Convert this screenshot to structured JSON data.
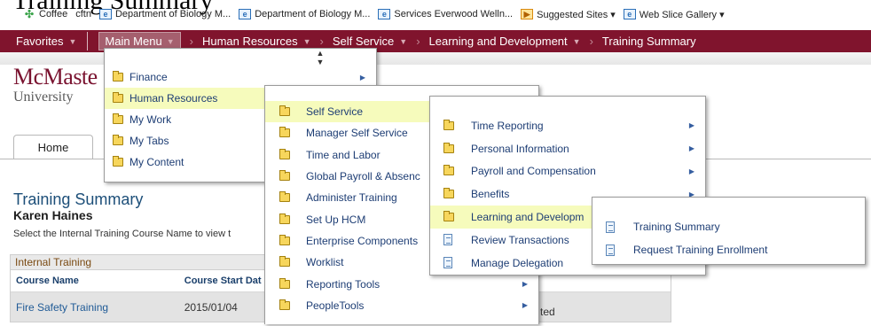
{
  "browser": {
    "page_title_fragment": "Training Summary",
    "favorites": [
      {
        "label": "Coffee",
        "icon": "green-leaf-icon"
      },
      {
        "label": "cftn",
        "icon": "page-icon"
      },
      {
        "label": "Department of Biology M...",
        "icon": "page-icon"
      },
      {
        "label": "Department of Biology M...",
        "icon": "page-icon"
      },
      {
        "label": "Services  Everwood Welln...",
        "icon": "page-icon"
      },
      {
        "label": "Suggested Sites ▾",
        "icon": "suggested-sites-icon"
      },
      {
        "label": "Web Slice Gallery ▾",
        "icon": "page-icon"
      }
    ]
  },
  "navbar": {
    "favorites": "Favorites",
    "main_menu": "Main Menu",
    "breadcrumbs": [
      "Human Resources",
      "Self Service",
      "Learning and Development",
      "Training Summary"
    ]
  },
  "logo": {
    "name": "McMaste",
    "sub": "University"
  },
  "tabs": [
    {
      "label": "Home"
    }
  ],
  "page": {
    "title": "Training Summary",
    "person": "Karen Haines",
    "instruction": "Select the Internal Training Course Name to view t"
  },
  "grid": {
    "title": "Internal Training",
    "columns": [
      "Course Name",
      "Course Start Dat",
      "",
      ""
    ],
    "rows": [
      {
        "course": "Fire Safety Training",
        "start": "2015/01/04",
        "col3": "",
        "status_fragment": "ted"
      }
    ]
  },
  "menus": {
    "main": [
      {
        "label": "Finance",
        "icon": "folder-icon",
        "arrow": true
      },
      {
        "label": "Human Resources",
        "icon": "folder-icon",
        "arrow": false,
        "highlighted": true
      },
      {
        "label": "My Work",
        "icon": "folder-icon",
        "arrow": false
      },
      {
        "label": "My Tabs",
        "icon": "folder-icon",
        "arrow": false
      },
      {
        "label": "My Content",
        "icon": "folder-icon",
        "arrow": false
      }
    ],
    "human_resources": [
      {
        "label": "Self Service",
        "icon": "folder-icon",
        "highlighted": true
      },
      {
        "label": "Manager Self Service",
        "icon": "folder-icon"
      },
      {
        "label": "Time and Labor",
        "icon": "folder-icon"
      },
      {
        "label": "Global Payroll & Absenc",
        "icon": "folder-icon"
      },
      {
        "label": "Administer Training",
        "icon": "folder-icon"
      },
      {
        "label": "Set Up HCM",
        "icon": "folder-icon"
      },
      {
        "label": "Enterprise Components",
        "icon": "folder-icon"
      },
      {
        "label": "Worklist",
        "icon": "folder-icon"
      },
      {
        "label": "Reporting Tools",
        "icon": "folder-icon",
        "arrow": true
      },
      {
        "label": "PeopleTools",
        "icon": "folder-icon",
        "arrow": true
      }
    ],
    "self_service": [
      {
        "label": "Time Reporting",
        "icon": "folder-icon",
        "arrow": true
      },
      {
        "label": "Personal Information",
        "icon": "folder-icon",
        "arrow": true
      },
      {
        "label": "Payroll and Compensation",
        "icon": "folder-icon",
        "arrow": true
      },
      {
        "label": "Benefits",
        "icon": "folder-icon",
        "arrow": true
      },
      {
        "label": "Learning and Developm",
        "icon": "folder-icon",
        "highlighted": true
      },
      {
        "label": "Review Transactions",
        "icon": "document-icon"
      },
      {
        "label": "Manage Delegation",
        "icon": "document-icon"
      }
    ],
    "learning": [
      {
        "label": "Training Summary",
        "icon": "document-icon"
      },
      {
        "label": "Request Training Enrollment",
        "icon": "document-icon"
      }
    ]
  },
  "colors": {
    "navbar": "#80142d",
    "menu_highlight": "#f6fbbc",
    "link": "#1d3d74",
    "title": "#1d4f79"
  }
}
